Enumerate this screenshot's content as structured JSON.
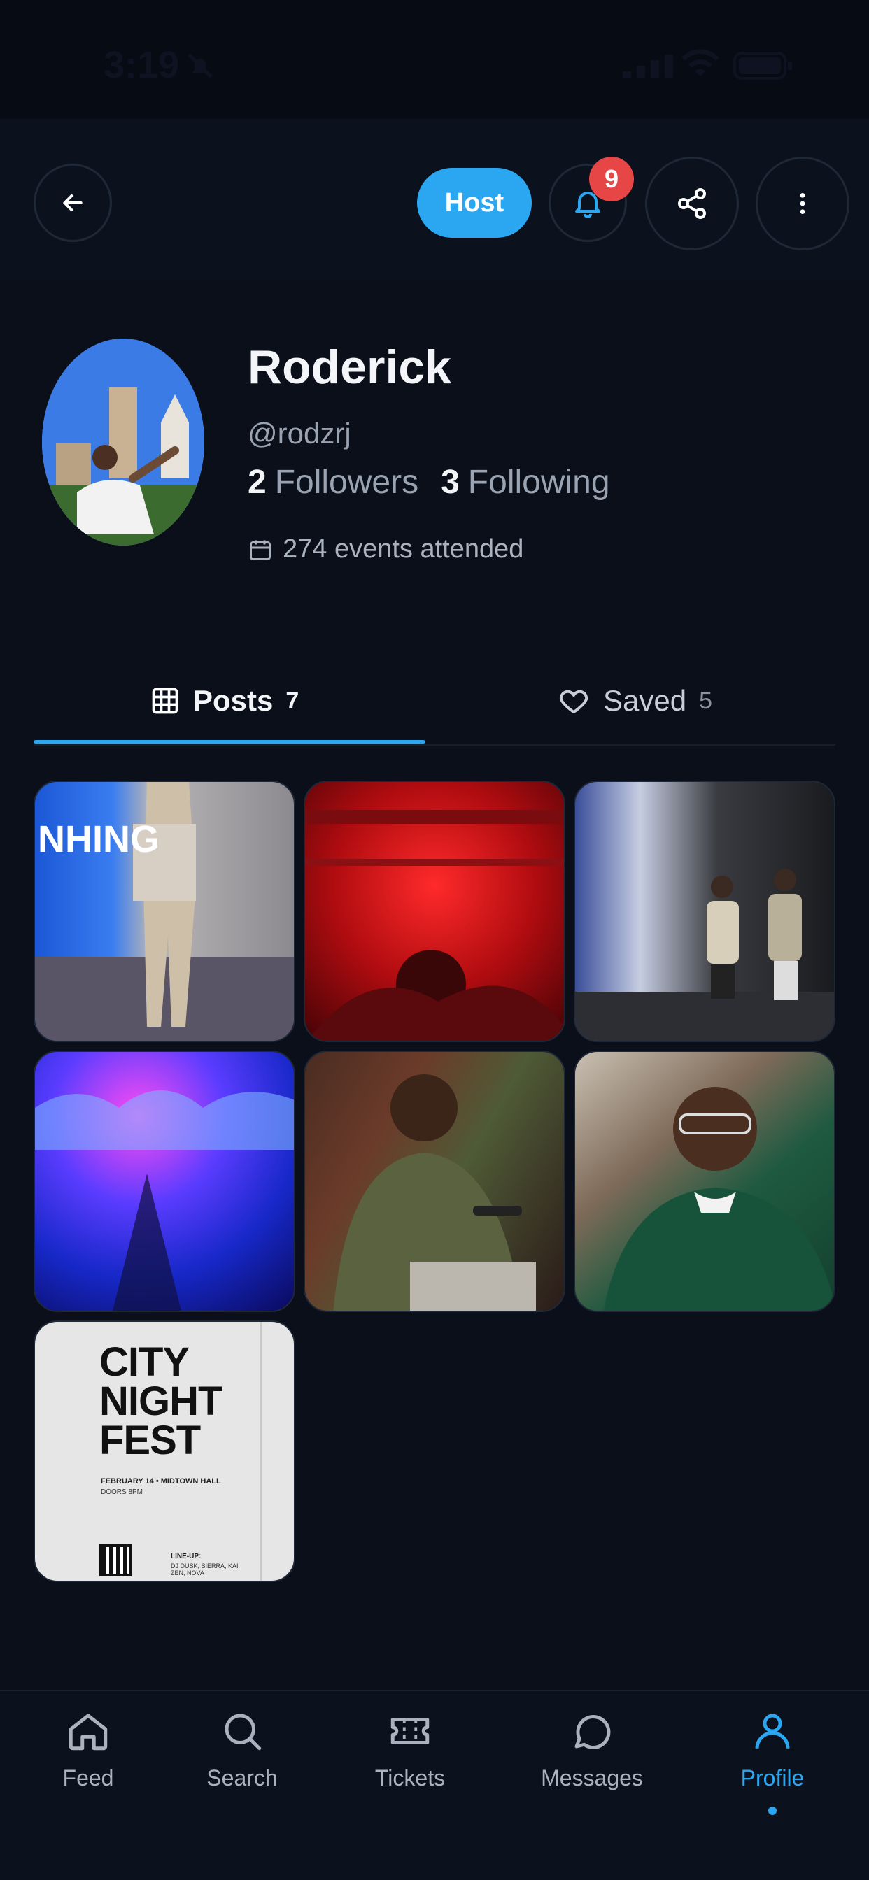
{
  "status_bar": {
    "time": "3:19"
  },
  "header": {
    "host_label": "Host",
    "notification_count": "9"
  },
  "profile": {
    "name": "Roderick",
    "handle": "@rodzrj",
    "followers_count": "2",
    "followers_label": "Followers",
    "following_count": "3",
    "following_label": "Following",
    "events_attended": "274 events attended"
  },
  "tabs": [
    {
      "label": "Posts",
      "count": "7"
    },
    {
      "label": "Saved",
      "count": "5"
    }
  ],
  "posts": [
    {
      "poster": {
        "title_line1": "CITY",
        "title_line2": "NIGHT",
        "title_line3": "FEST",
        "date_line": "FEBRUARY 14 • MIDTOWN HALL",
        "doors": "DOORS 8PM",
        "lineup_title": "LINE-UP:",
        "lineup": "DJ DUSK, SIERRA, KAI ZEN, NOVA"
      }
    }
  ],
  "bottom_nav": [
    {
      "label": "Feed",
      "icon": "home-icon"
    },
    {
      "label": "Search",
      "icon": "search-icon"
    },
    {
      "label": "Tickets",
      "icon": "ticket-icon"
    },
    {
      "label": "Messages",
      "icon": "chat-bubble-icon"
    },
    {
      "label": "Profile",
      "icon": "person-icon"
    }
  ],
  "colors": {
    "accent": "#2aa7f0",
    "background": "#0a0f1a",
    "badge": "#e64646"
  }
}
